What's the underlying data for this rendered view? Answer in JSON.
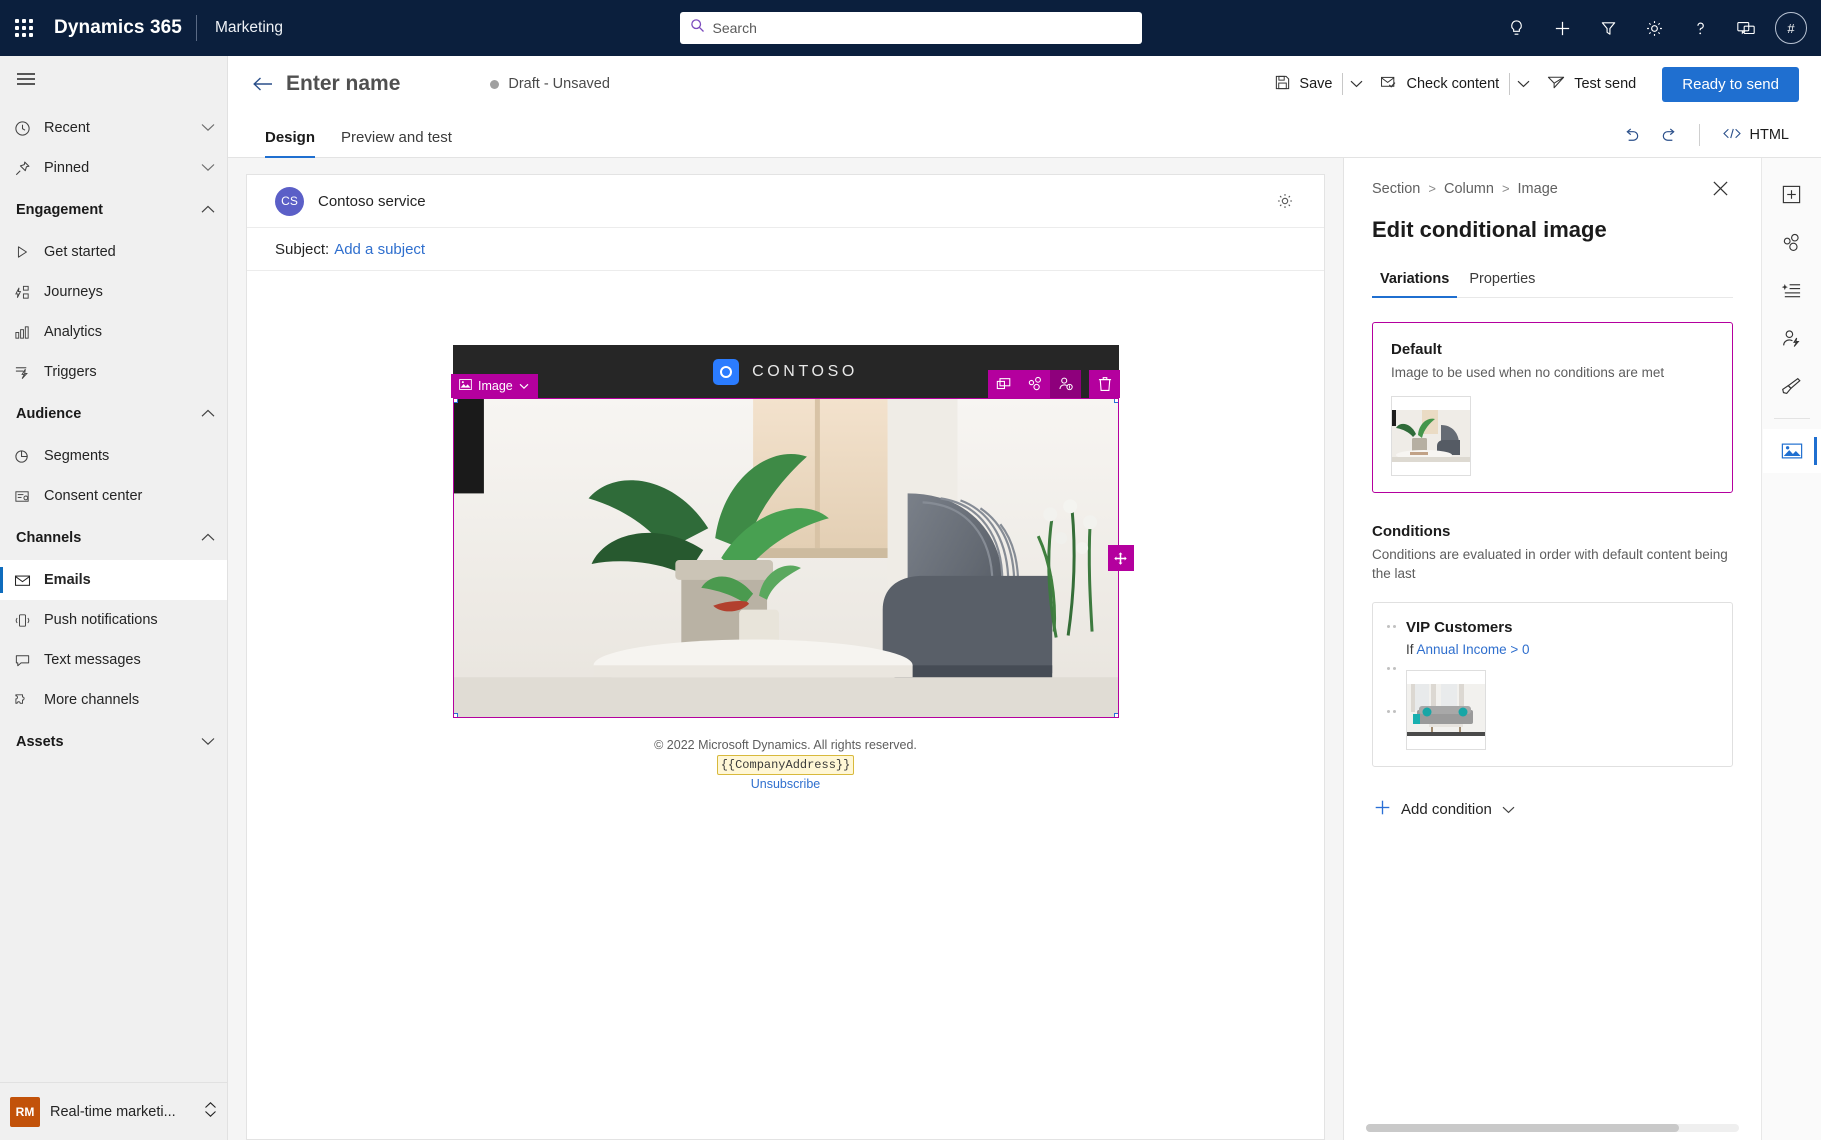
{
  "suite": {
    "waffle_label": "app-launcher",
    "brand": "Dynamics 365",
    "app_name": "Marketing",
    "search_placeholder": "Search",
    "icons": [
      {
        "name": "insights-idea-icon",
        "glyph": "lightbulb"
      },
      {
        "name": "quick-create-icon",
        "glyph": "plus"
      },
      {
        "name": "filter-icon",
        "glyph": "funnel"
      },
      {
        "name": "settings-gear-icon",
        "glyph": "gear"
      },
      {
        "name": "help-icon",
        "glyph": "question"
      },
      {
        "name": "feedback-icon",
        "glyph": "chat"
      }
    ],
    "avatar_initials": "#"
  },
  "leftnav": {
    "items": [
      {
        "label": "Recent",
        "icon": "clock-icon",
        "type": "expandable",
        "selected": false
      },
      {
        "label": "Pinned",
        "icon": "pin-icon",
        "type": "expandable",
        "selected": false
      }
    ],
    "groups": [
      {
        "label": "Engagement",
        "expanded": true,
        "items": [
          {
            "label": "Get started",
            "icon": "play-icon",
            "selected": false
          },
          {
            "label": "Journeys",
            "icon": "journeys-icon",
            "selected": false
          },
          {
            "label": "Analytics",
            "icon": "analytics-icon",
            "selected": false
          },
          {
            "label": "Triggers",
            "icon": "triggers-icon",
            "selected": false
          }
        ]
      },
      {
        "label": "Audience",
        "expanded": true,
        "items": [
          {
            "label": "Segments",
            "icon": "segments-icon",
            "selected": false
          },
          {
            "label": "Consent center",
            "icon": "consent-icon",
            "selected": false
          }
        ]
      },
      {
        "label": "Channels",
        "expanded": true,
        "items": [
          {
            "label": "Emails",
            "icon": "envelope-icon",
            "selected": true
          },
          {
            "label": "Push notifications",
            "icon": "push-icon",
            "selected": false
          },
          {
            "label": "Text messages",
            "icon": "sms-icon",
            "selected": false
          },
          {
            "label": "More channels",
            "icon": "more-channels-icon",
            "selected": false
          }
        ]
      },
      {
        "label": "Assets",
        "expanded": false,
        "items": []
      }
    ],
    "area_switcher": {
      "initials": "RM",
      "label": "Real-time marketi..."
    }
  },
  "commandbar": {
    "back_label": "Back",
    "page_title": "Enter name",
    "status": "Draft - Unsaved",
    "save_label": "Save",
    "check_content_label": "Check content",
    "test_send_label": "Test send",
    "ready_to_send_label": "Ready to send",
    "primary_color": "#1f6fd0"
  },
  "tabbar": {
    "tabs": [
      {
        "label": "Design",
        "active": true
      },
      {
        "label": "Preview and test",
        "active": false
      }
    ],
    "undo_label": "Undo",
    "redo_label": "Redo",
    "html_label": "HTML"
  },
  "canvas": {
    "sender_initials": "CS",
    "sender_name": "Contoso service",
    "settings_label": "Email settings",
    "subject_label": "Subject:",
    "subject_link": "Add a subject",
    "email": {
      "banner_word": "CONTOSO",
      "selected_element": {
        "type_label": "Image",
        "toolbar": [
          {
            "name": "duplicate-icon"
          },
          {
            "name": "variations-icon"
          },
          {
            "name": "personalize-icon"
          },
          {
            "name": "delete-icon"
          }
        ],
        "drag_label": "Move element"
      },
      "footer": {
        "copyright": "© 2022 Microsoft Dynamics. All rights reserved.",
        "address_token": "{{CompanyAddress}}",
        "unsubscribe": "Unsubscribe"
      }
    }
  },
  "rightpanel": {
    "breadcrumb": [
      "Section",
      "Column",
      "Image"
    ],
    "close_label": "Close",
    "title": "Edit conditional image",
    "tabs": [
      {
        "label": "Variations",
        "active": true
      },
      {
        "label": "Properties",
        "active": false
      }
    ],
    "default_card": {
      "title": "Default",
      "subtitle": "Image to be used when no conditions are met",
      "thumb_name": "default-image-thumbnail"
    },
    "conditions_section": {
      "title": "Conditions",
      "subtitle": "Conditions are evaluated in order with default content being the last",
      "items": [
        {
          "name": "VIP Customers",
          "if_prefix": "If",
          "if_expression": "Annual Income > 0",
          "thumb_name": "vip-image-thumbnail"
        }
      ],
      "add_label": "Add condition"
    },
    "accent_color": "#b4009e"
  },
  "rail": {
    "buttons": [
      {
        "name": "add-element-icon",
        "active": false
      },
      {
        "name": "layouts-icon",
        "active": false
      },
      {
        "name": "templates-icon",
        "active": false
      },
      {
        "name": "personalization-icon",
        "active": false
      },
      {
        "name": "styles-brush-icon",
        "active": false
      },
      {
        "name": "image-properties-icon",
        "active": true
      }
    ]
  }
}
